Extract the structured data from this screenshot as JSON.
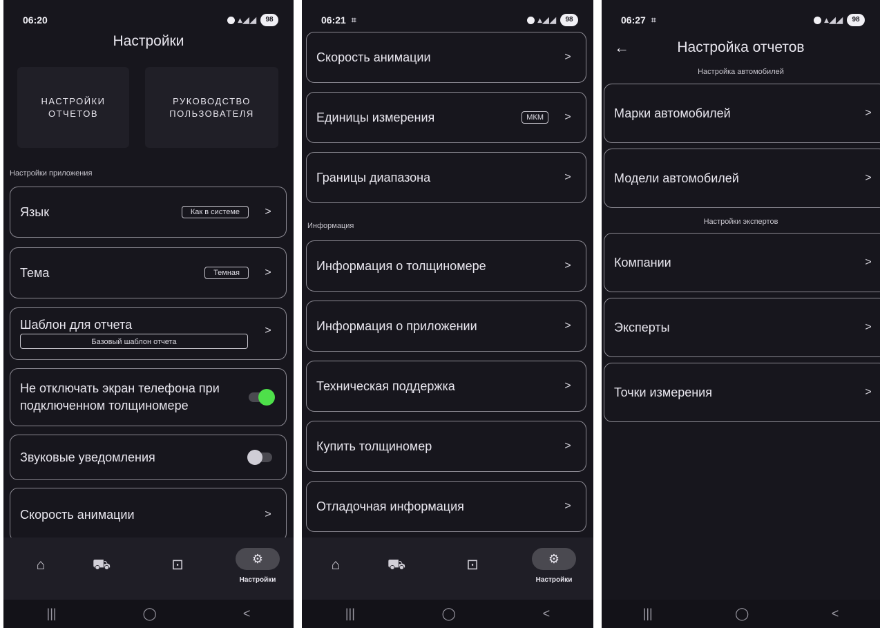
{
  "screen1": {
    "status": {
      "time": "06:20",
      "battery": "98"
    },
    "title": "Настройки",
    "report_settings_button": "НАСТРОЙКИ ОТЧЕТОВ",
    "user_guide_button": "РУКОВОДСТВО ПОЛЬЗОВАТЕЛЯ",
    "section_app": "Настройки приложения",
    "items": [
      {
        "label": "Язык",
        "badge": "Как в системе"
      },
      {
        "label": "Тема",
        "badge": "Темная"
      },
      {
        "label": "Шаблон для отчета",
        "value": "Базовый шаблон отчета"
      },
      {
        "label": "Не отключать экран телефона при подключенном толщиномере",
        "toggle": true
      },
      {
        "label": "Звуковые уведомления",
        "toggle": false
      },
      {
        "label": "Скорость анимации"
      }
    ],
    "nav": {
      "settings_label": "Настройки"
    }
  },
  "screen2": {
    "status": {
      "time": "06:21",
      "battery": "98"
    },
    "items_top": [
      {
        "label": "Скорость анимации"
      },
      {
        "label": "Единицы измерения",
        "badge": "МКМ"
      },
      {
        "label": "Границы диапазона"
      }
    ],
    "section_info": "Информация",
    "items_info": [
      {
        "label": "Информация о толщиномере"
      },
      {
        "label": "Информация о приложении"
      },
      {
        "label": "Техническая поддержка"
      },
      {
        "label": "Купить толщиномер"
      },
      {
        "label": "Отладочная информация"
      }
    ],
    "nav": {
      "settings_label": "Настройки"
    }
  },
  "screen3": {
    "status": {
      "time": "06:27",
      "battery": "98"
    },
    "title": "Настройка отчетов",
    "section_cars": "Настройка автомобилей",
    "cars_items": [
      {
        "label": "Марки автомобилей"
      },
      {
        "label": "Модели автомобилей"
      }
    ],
    "section_experts": "Настройки экспертов",
    "experts_items": [
      {
        "label": "Компании"
      },
      {
        "label": "Эксперты"
      },
      {
        "label": "Точки измерения"
      }
    ]
  },
  "colors": {
    "background": "#17161d",
    "card_border": "#8c8a93",
    "toggle_on": "#4ee04a",
    "nav_pill": "#4a4950"
  },
  "icons": {
    "home": "home-icon",
    "car": "car-icon",
    "archive": "archive-icon",
    "settings": "gear-icon"
  }
}
